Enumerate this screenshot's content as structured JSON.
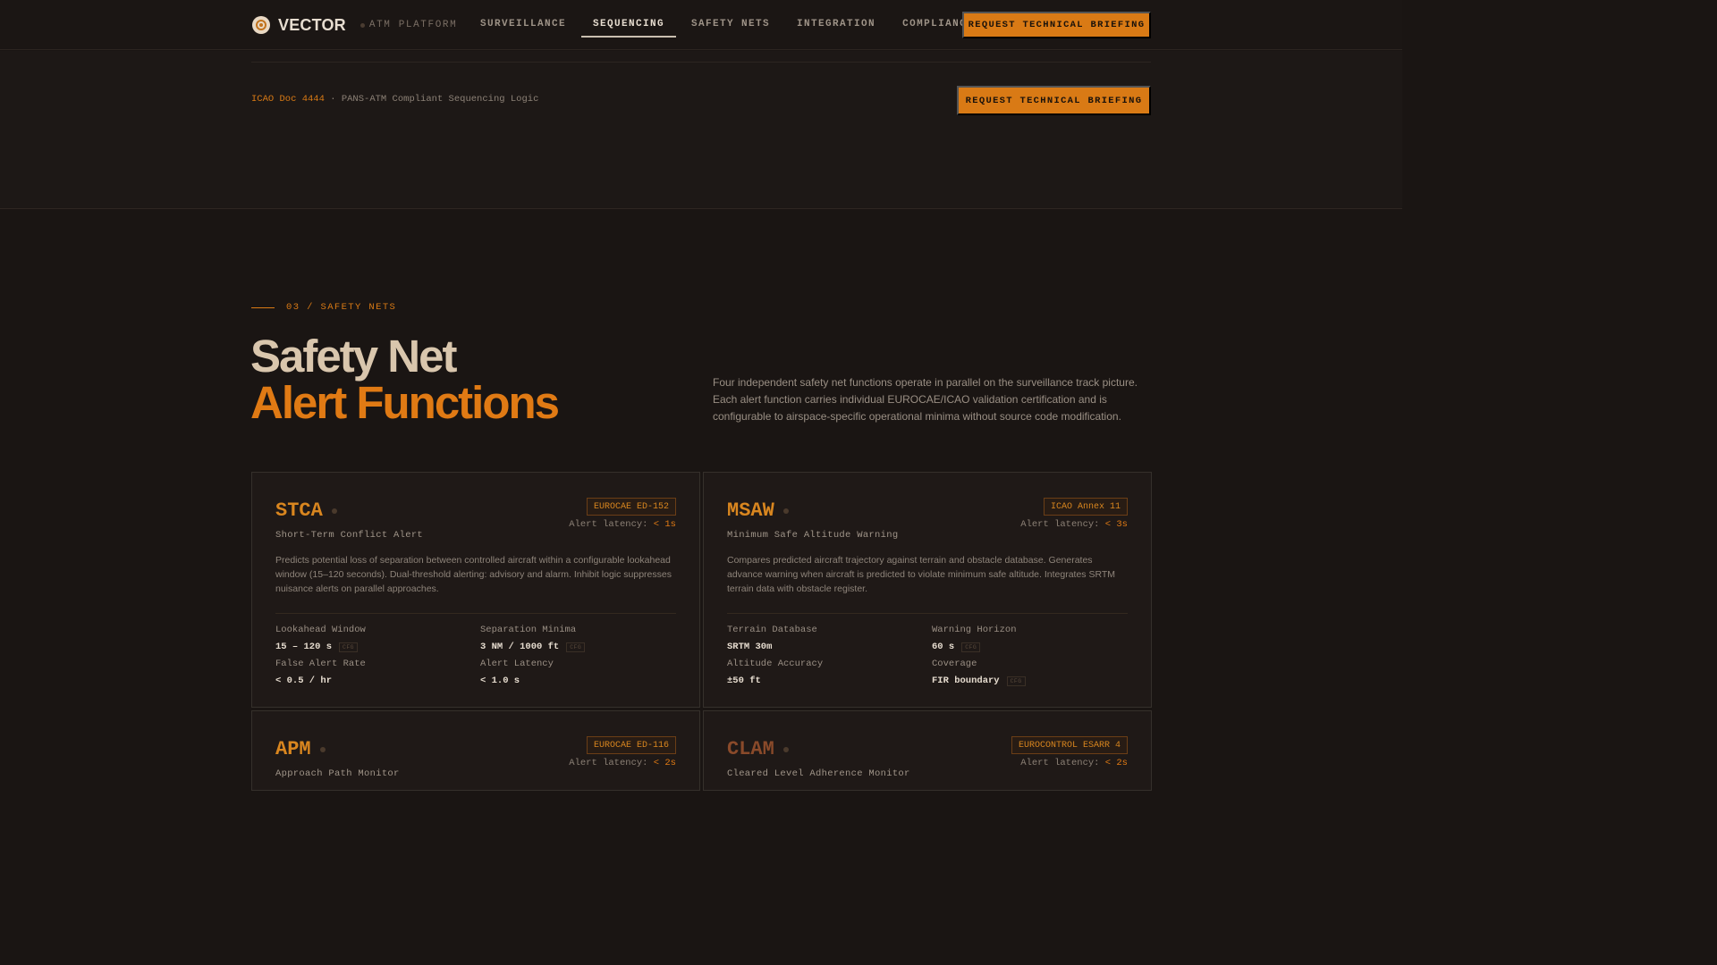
{
  "nav": {
    "brand": "VECTOR",
    "platform": "ATM PLATFORM",
    "links": [
      "SURVEILLANCE",
      "SEQUENCING",
      "SAFETY NETS",
      "INTEGRATION",
      "COMPLIANCE"
    ],
    "active": "SEQUENCING",
    "cta": "REQUEST TECHNICAL BRIEFING"
  },
  "band": {
    "crumb_highlight": "ICAO Doc 4444",
    "crumb_sep": " · ",
    "crumb_text": "PANS-ATM Compliant Sequencing Logic",
    "cta": "REQUEST TECHNICAL BRIEFING"
  },
  "section": {
    "label": "03 / SAFETY NETS",
    "title_line1": "Safety Net",
    "title_line2": "Alert Functions",
    "intro": "Four independent safety net functions operate in parallel on the surveillance track picture. Each alert function carries individual EUROCAE/ICAO validation certification and is configurable to airspace-specific operational minima without source code modification."
  },
  "cards": [
    {
      "title": "STCA",
      "subtitle": "Short-Term Conflict Alert",
      "badge": "EUROCAE ED-152",
      "latency_label": "Alert latency: ",
      "latency_value": "< 1s",
      "desc": "Predicts potential loss of separation between controlled aircraft within a configurable lookahead window (15–120 seconds). Dual-threshold alerting: advisory and alarm. Inhibit logic suppresses nuisance alerts on parallel approaches.",
      "stats": [
        {
          "k": "Lookahead Window",
          "v": "15 – 120 s",
          "cfg": "CFG"
        },
        {
          "k": "Separation Minima",
          "v": "3 NM / 1000 ft",
          "cfg": "CFG"
        },
        {
          "k": "False Alert Rate",
          "v": "< 0.5 / hr",
          "cfg": ""
        },
        {
          "k": "Alert Latency",
          "v": "< 1.0 s",
          "cfg": ""
        }
      ]
    },
    {
      "title": "MSAW",
      "subtitle": "Minimum Safe Altitude Warning",
      "badge": "ICAO Annex 11",
      "latency_label": "Alert latency: ",
      "latency_value": "< 3s",
      "desc": "Compares predicted aircraft trajectory against terrain and obstacle database. Generates advance warning when aircraft is predicted to violate minimum safe altitude. Integrates SRTM terrain data with obstacle register.",
      "stats": [
        {
          "k": "Terrain Database",
          "v": "SRTM 30m",
          "cfg": ""
        },
        {
          "k": "Warning Horizon",
          "v": "60 s",
          "cfg": "CFG"
        },
        {
          "k": "Altitude Accuracy",
          "v": "±50 ft",
          "cfg": ""
        },
        {
          "k": "Coverage",
          "v": "FIR boundary",
          "cfg": "CFG"
        }
      ]
    },
    {
      "title": "APM",
      "subtitle": "Approach Path Monitor",
      "badge": "EUROCAE ED-116",
      "latency_label": "Alert latency: ",
      "latency_value": "< 2s"
    },
    {
      "title": "CLAM",
      "subtitle": "Cleared Level Adherence Monitor",
      "badge": "EUROCONTROL ESARR 4",
      "latency_label": "Alert latency: ",
      "latency_value": "< 2s"
    }
  ]
}
